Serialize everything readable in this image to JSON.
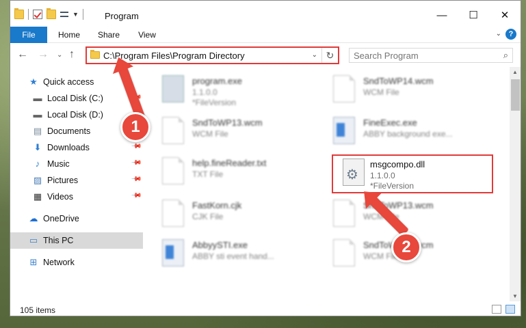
{
  "window": {
    "title": "Program",
    "controls": {
      "minimize": "—",
      "maximize": "☐",
      "close": "✕"
    }
  },
  "ribbon": {
    "tabs": [
      "File",
      "Home",
      "Share",
      "View"
    ],
    "help_label": "?"
  },
  "address": {
    "path": "C:\\Program Files\\Program Directory",
    "search_placeholder": "Search Program"
  },
  "sidebar": {
    "items": [
      {
        "label": "Quick access",
        "icon": "star-icon"
      },
      {
        "label": "Local Disk (C:)",
        "icon": "drive-icon",
        "pinned": true
      },
      {
        "label": "Local Disk (D:)",
        "icon": "drive-icon",
        "pinned": true
      },
      {
        "label": "Documents",
        "icon": "documents-icon",
        "pinned": true
      },
      {
        "label": "Downloads",
        "icon": "download-icon",
        "pinned": true
      },
      {
        "label": "Music",
        "icon": "music-icon",
        "pinned": true
      },
      {
        "label": "Pictures",
        "icon": "pictures-icon",
        "pinned": true
      },
      {
        "label": "Videos",
        "icon": "videos-icon",
        "pinned": true
      },
      {
        "label": "OneDrive",
        "icon": "cloud-icon"
      },
      {
        "label": "This PC",
        "icon": "computer-icon",
        "selected": true
      },
      {
        "label": "Network",
        "icon": "network-icon"
      }
    ]
  },
  "files": [
    {
      "name": "program.exe",
      "line2": "1.1.0.0",
      "line3": "*FileVersion",
      "icon": "app-icon"
    },
    {
      "name": "SndToWP14.wcm",
      "line2": "WCM File",
      "icon": "document-icon"
    },
    {
      "name": "SndToWP13.wcm",
      "line2": "WCM File",
      "icon": "document-icon"
    },
    {
      "name": "FineExec.exe",
      "line2": "ABBY background exe...",
      "icon": "exe-icon"
    },
    {
      "name": "help.fineReader.txt",
      "line2": "TXT File",
      "icon": "document-icon"
    },
    {
      "name": "msgcompo.dll",
      "line2": "1.1.0.0",
      "line3": "*FileVersion",
      "icon": "dll-icon",
      "highlighted": true
    },
    {
      "name": "FastKorn.cjk",
      "line2": "CJK File",
      "icon": "document-icon"
    },
    {
      "name": "SndToWP13.wcm",
      "line2": "WCM File",
      "icon": "document-icon"
    },
    {
      "name": "AbbyySTI.exe",
      "line2": "ABBY sti event hand...",
      "icon": "exe-icon"
    },
    {
      "name": "SndToWP13.wcm",
      "line2": "WCM File",
      "icon": "document-icon"
    }
  ],
  "status": {
    "item_count": "105 items"
  },
  "annotations": {
    "step1": "1",
    "step2": "2"
  },
  "colors": {
    "accent": "#1979ca",
    "highlight": "#e03a3a",
    "annotation": "#e8473c"
  }
}
